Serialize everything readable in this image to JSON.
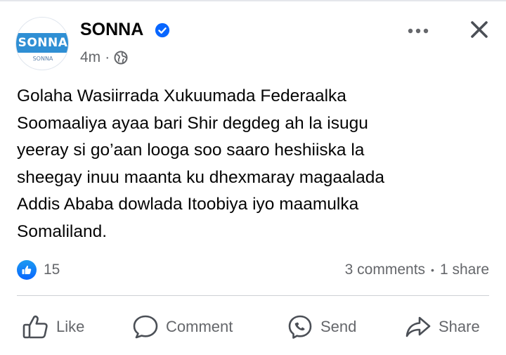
{
  "post": {
    "page_name": "SONNA",
    "avatar": {
      "logo_text": "SONNA",
      "logo_subtext": "SONNA"
    },
    "time": "4m",
    "separator": "·",
    "icons": {
      "verified": "verified-badge-icon",
      "audience": "globe-icon",
      "more": "more-options-icon",
      "close": "close-icon"
    },
    "text": "Golaha Wasiirrada Xukuumada Federaalka\nSoomaaliya ayaa bari Shir degdeg ah  la isugu\nyeeray si go’aan looga soo saaro heshiiska la\nsheegay inuu maanta ku dhexmaray magaalada\nAddis Ababa dowlada Itoobiya iyo maamulka\nSomaliland."
  },
  "stats": {
    "likes": "15",
    "comments": "3 comments",
    "separator": "•",
    "shares": "1 share"
  },
  "actions": [
    {
      "label": "Like",
      "icon": "thumbs-up-icon"
    },
    {
      "label": "Comment",
      "icon": "comment-bubble-icon"
    },
    {
      "label": "Send",
      "icon": "messenger-icon"
    },
    {
      "label": "Share",
      "icon": "share-arrow-icon"
    }
  ],
  "colors": {
    "text_primary": "#050505",
    "text_secondary": "#65676b",
    "accent_blue": "#0866ff",
    "logo_blue": "#2f8fd4",
    "divider": "#ced0d4"
  }
}
